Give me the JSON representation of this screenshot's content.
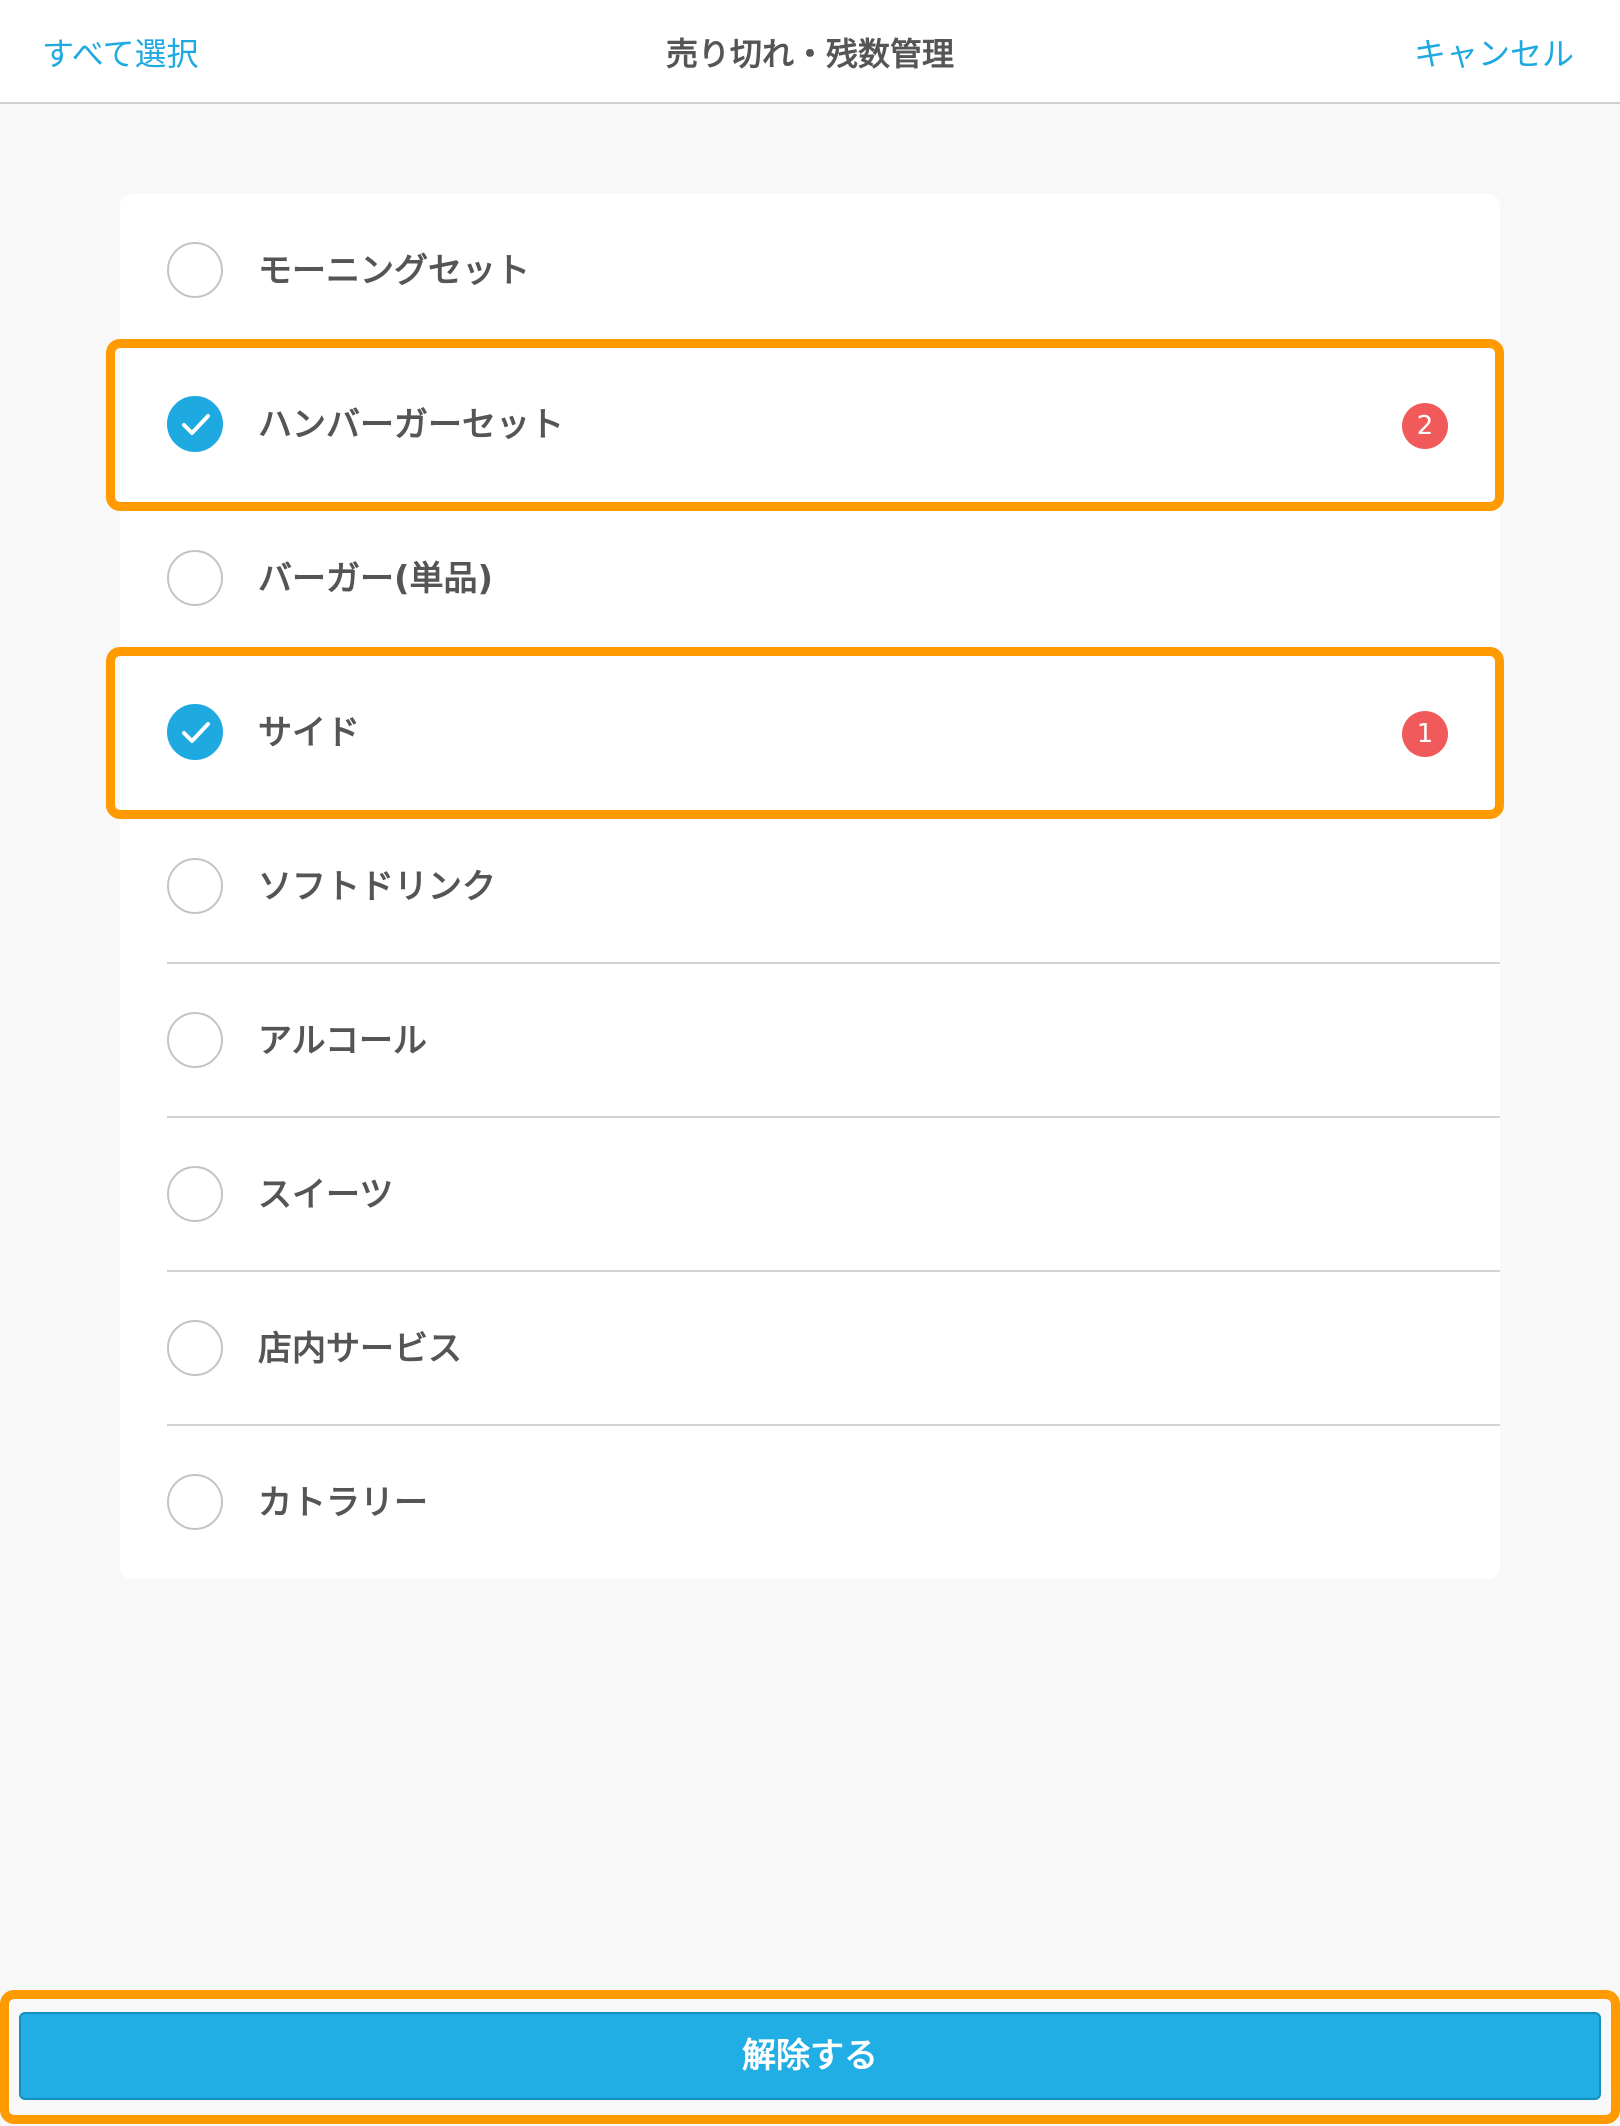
{
  "nav": {
    "select_all": "すべて選択",
    "title": "売り切れ・残数管理",
    "cancel": "キャンセル"
  },
  "items": [
    {
      "label": "モーニングセット",
      "checked": false,
      "badge": ""
    },
    {
      "label": "ハンバーガーセット",
      "checked": true,
      "badge": "2"
    },
    {
      "label": "バーガー(単品)",
      "checked": false,
      "badge": ""
    },
    {
      "label": "サイド",
      "checked": true,
      "badge": "1"
    },
    {
      "label": "ソフトドリンク",
      "checked": false,
      "badge": ""
    },
    {
      "label": "アルコール",
      "checked": false,
      "badge": ""
    },
    {
      "label": "スイーツ",
      "checked": false,
      "badge": ""
    },
    {
      "label": "店内サービス",
      "checked": false,
      "badge": ""
    },
    {
      "label": "カトラリー",
      "checked": false,
      "badge": ""
    }
  ],
  "footer": {
    "release_button": "解除する"
  },
  "colors": {
    "accent": "#1ea9e1",
    "badge": "#f05a5a",
    "highlight": "#ff9a00",
    "text": "#555555"
  },
  "icons": {
    "checkmark": "checkmark-icon"
  }
}
